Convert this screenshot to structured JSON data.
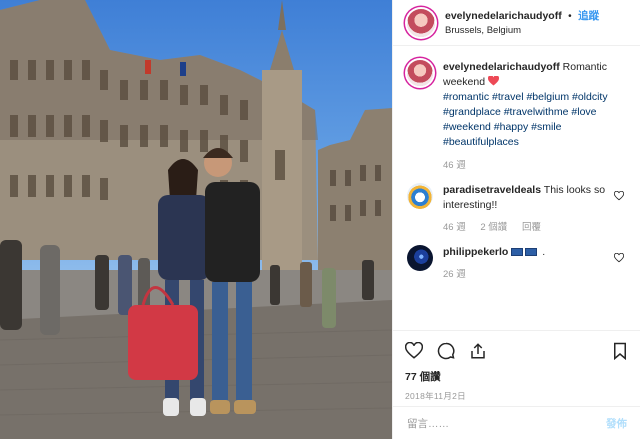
{
  "post": {
    "username": "evelynedelarichaudyoff",
    "follow_label": "追蹤",
    "location": "Brussels, Belgium",
    "caption_text": "Romantic weekend",
    "hashtags": "#romantic #travel #belgium #oldcity #grandplace #travelwithme #love #weekend #happy #smile #beautifulplaces",
    "caption_age": "46 週"
  },
  "comments": [
    {
      "username": "paradisetraveldeals",
      "text": "This looks so interesting!!",
      "age": "46 週",
      "likes": "2 個讚",
      "reply": "回覆"
    },
    {
      "username": "philippekerlo",
      "text": ".",
      "age": "26 週"
    }
  ],
  "likes_count": "77 個讚",
  "date": "2018年11月2日",
  "add_comment": {
    "placeholder": "留言……",
    "post_label": "發佈"
  },
  "icons": [
    "heart-icon",
    "comment-icon",
    "share-icon",
    "bookmark-icon",
    "flag-icon"
  ],
  "colors": {
    "follow": "#3897f0",
    "heart": "#ed4956",
    "hashtag": "#003569",
    "muted": "#999999"
  }
}
